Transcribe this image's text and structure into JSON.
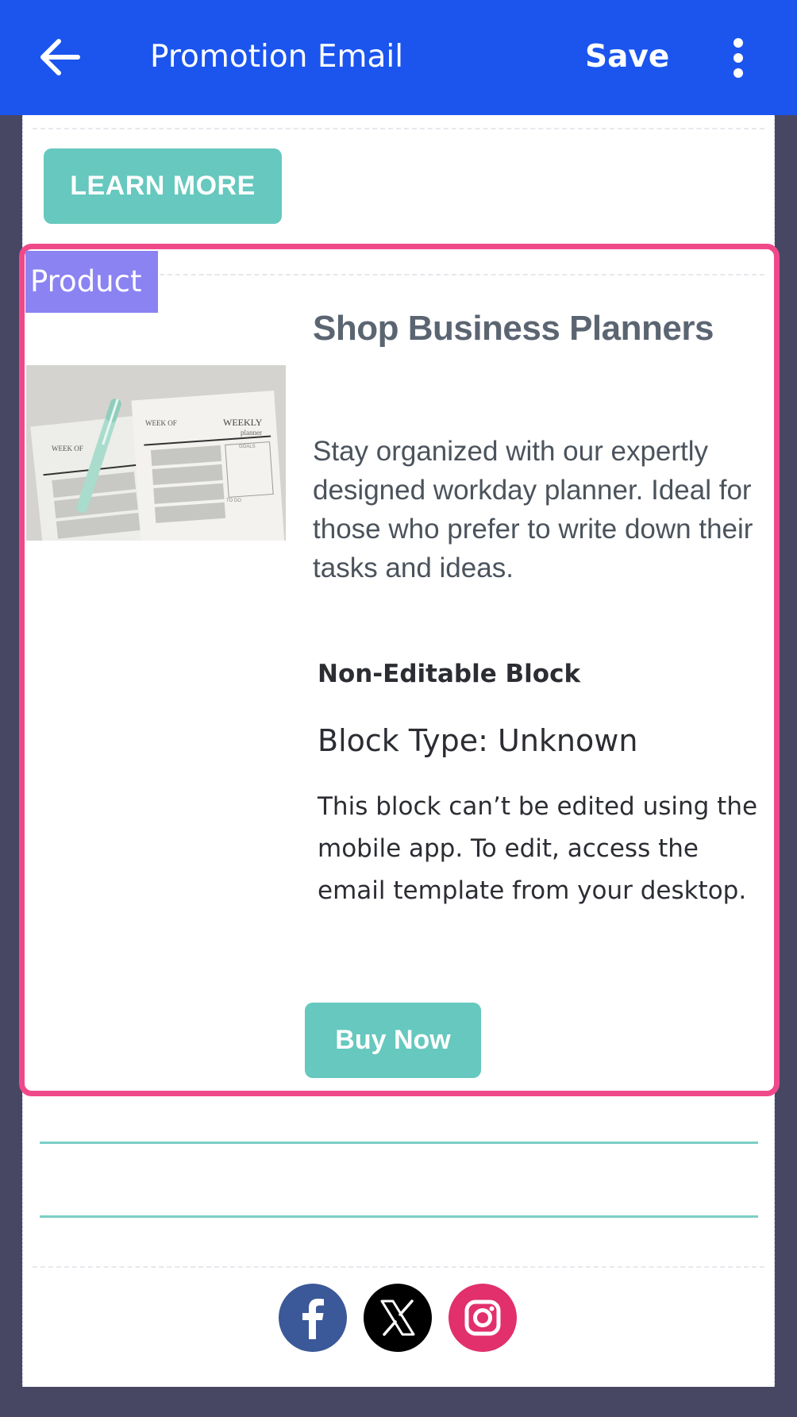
{
  "appbar": {
    "title": "Promotion Email",
    "save_label": "Save",
    "bg_color": "#1b55ee"
  },
  "email": {
    "learn_more_label": "LEARN MORE",
    "button_color": "#66c8be",
    "product_block": {
      "tag_label": "Product",
      "selection_color": "#f0498a",
      "heading": "Shop Business Planners",
      "description": "Stay organized with our expertly designed workday planner. Ideal for those who prefer to write down their tasks and ideas.",
      "image_icon": "planner-photo",
      "image_texts": {
        "week_of_left": "WEEK OF",
        "week_of_right": "WEEK OF",
        "weekly": "WEEKLY",
        "planner": "planner",
        "goals": "GOALS",
        "todo": "TO DO"
      },
      "non_editable": {
        "title": "Non-Editable Block",
        "block_type": "Block Type: Unknown",
        "message": "This block can’t be edited using the mobile app. To edit, access the email template from your desktop."
      },
      "buy_label": "Buy Now"
    },
    "social_icons": [
      {
        "name": "facebook-icon",
        "color": "#3b5998"
      },
      {
        "name": "x-icon",
        "color": "#000000"
      },
      {
        "name": "instagram-icon",
        "color": "#e1306c"
      }
    ]
  }
}
